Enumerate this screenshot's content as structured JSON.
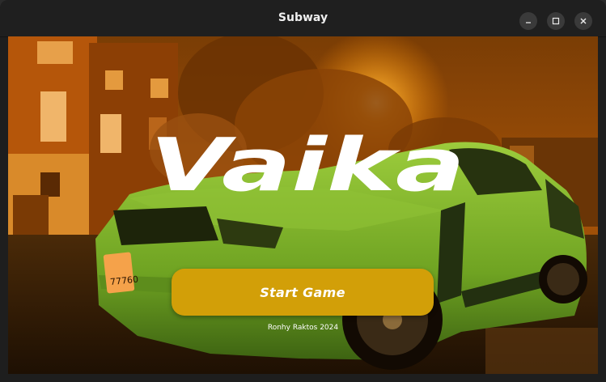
{
  "window": {
    "title": "Subway",
    "controls": [
      "minimize-icon",
      "maximize-icon",
      "close-icon"
    ]
  },
  "game": {
    "logo_text": "Vaika",
    "start_button_label": "Start Game",
    "credit": "Ronhy Raktos 2024",
    "license_plate": "77760"
  },
  "colors": {
    "accent_button": "#d29f08",
    "car_body": "#7fb82a",
    "scene_tint": "#c8690d",
    "titlebar": "#1f1f1f"
  }
}
